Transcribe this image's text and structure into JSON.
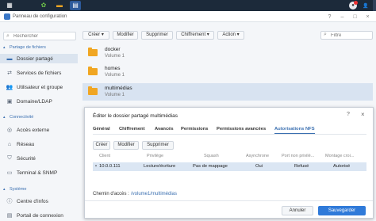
{
  "window": {
    "title": "Panneau de configuration"
  },
  "sidebar": {
    "search_placeholder": "Rechercher",
    "sections": [
      {
        "label": "Partage de fichiers",
        "items": [
          "Dossier partagé",
          "Services de fichiers",
          "Utilisateur et groupe",
          "Domaine/LDAP"
        ]
      },
      {
        "label": "Connectivité",
        "items": [
          "Accès externe",
          "Réseau",
          "Sécurité",
          "Terminal & SNMP"
        ]
      },
      {
        "label": "Système",
        "items": [
          "Centre d'infos",
          "Portail de connexion"
        ]
      }
    ]
  },
  "toolbar": {
    "create": "Créer",
    "edit": "Modifier",
    "delete": "Supprimer",
    "encryption": "Chiffrement",
    "action": "Action",
    "filter_placeholder": "Filtre"
  },
  "folders": [
    {
      "name": "docker",
      "volume": "Volume 1"
    },
    {
      "name": "homes",
      "volume": "Volume 1"
    },
    {
      "name": "multimédias",
      "volume": "Volume 1"
    }
  ],
  "dialog": {
    "title": "Éditer le dossier partagé multimédias",
    "tabs": [
      "Général",
      "Chiffrement",
      "Avancés",
      "Permissions",
      "Permissions avancées",
      "Autorisations NFS"
    ],
    "buttons": {
      "create": "Créer",
      "edit": "Modifier",
      "delete": "Supprimer"
    },
    "columns": [
      "Client",
      "Privilège",
      "Squash",
      "Asynchrone",
      "Port non privilé...",
      "Montage croi..."
    ],
    "rows": [
      [
        "10.0.0.111",
        "Lecture/écriture",
        "Pas de mappage",
        "Oui",
        "Refusé",
        "Autorisé"
      ]
    ],
    "path_label": "Chemin d'accès :",
    "path_value": "/volume1/multimédias",
    "cancel": "Annuler",
    "save": "Sauvegarder"
  },
  "colors": {
    "accent": "#3a6fb0",
    "primary_button": "#2f7ad9",
    "folder": "#f0a623"
  }
}
